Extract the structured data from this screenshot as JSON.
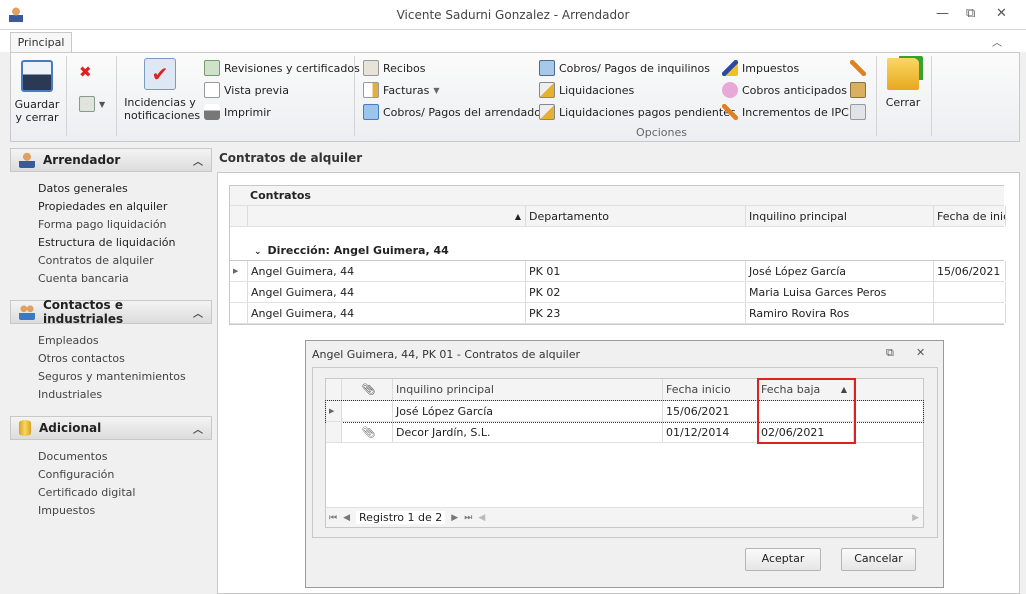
{
  "window": {
    "title": "Vicente Sadurni Gonzalez - Arrendador",
    "minimize": "—",
    "restore": "⧉",
    "close": "✕"
  },
  "ribbon": {
    "tab": "Principal",
    "save_close": [
      "Guardar",
      "y cerrar"
    ],
    "incidencias": [
      "Incidencias y",
      "notificaciones"
    ],
    "col1": [
      "Revisiones y certificados",
      "Vista previa",
      "Imprimir"
    ],
    "col2": [
      "Recibos",
      "Facturas",
      "Cobros/ Pagos del arrendador"
    ],
    "col3": [
      "Cobros/ Pagos de inquilinos",
      "Liquidaciones",
      "Liquidaciones pagos pendientes"
    ],
    "col4": [
      "Impuestos",
      "Cobros anticipados",
      "Incrementos de IPC"
    ],
    "group_label": "Opciones",
    "close": "Cerrar"
  },
  "sidebar": {
    "groups": [
      {
        "title": "Arrendador",
        "items": [
          "Datos generales",
          "Propiedades en alquiler",
          "Forma pago liquidación",
          "Estructura de liquidación",
          "Contratos de alquiler",
          "Cuenta bancaria"
        ]
      },
      {
        "title": "Contactos e industriales",
        "items": [
          "Empleados",
          "Otros contactos",
          "Seguros y mantenimientos",
          "Industriales"
        ]
      },
      {
        "title": "Adicional",
        "items": [
          "Documentos",
          "Configuración",
          "Certificado digital",
          "Impuestos"
        ]
      }
    ]
  },
  "main": {
    "title": "Contratos de alquiler",
    "grid_title": "Contratos",
    "columns": [
      "",
      "Departamento",
      "Inquilino principal",
      "Fecha de inici"
    ],
    "group_row": "Dirección: Angel Guimera, 44",
    "rows": [
      [
        "Angel Guimera, 44",
        "PK 01",
        "José López García",
        "15/06/2021"
      ],
      [
        "Angel Guimera, 44",
        "PK 02",
        "Maria Luisa Garces Peros",
        ""
      ],
      [
        "Angel Guimera, 44",
        "PK 23",
        "Ramiro Rovira Ros",
        ""
      ]
    ]
  },
  "dialog": {
    "title": "Angel Guimera, 44, PK 01 - Contratos de alquiler",
    "columns": [
      "Inquilino principal",
      "Fecha inicio",
      "Fecha baja"
    ],
    "rows": [
      {
        "attach": false,
        "inquilino": "José López García",
        "inicio": "15/06/2021",
        "baja": ""
      },
      {
        "attach": true,
        "inquilino": "Decor Jardín, S.L.",
        "inicio": "01/12/2014",
        "baja": "02/06/2021"
      }
    ],
    "nav": "Registro 1 de 2",
    "accept": "Aceptar",
    "cancel": "Cancelar",
    "highlight_color": "#e02020"
  }
}
